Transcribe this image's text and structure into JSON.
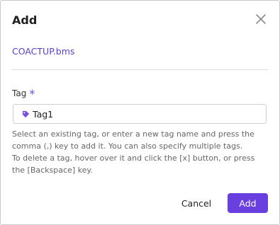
{
  "dialog": {
    "title": "Add",
    "close_icon": "close-icon"
  },
  "file": {
    "name": "COACTUP.bms"
  },
  "tag_field": {
    "label": "Tag",
    "required_marker": "*",
    "tags": [
      "Tag1"
    ],
    "tag_icon": "tag-icon",
    "help_lines": [
      "Select an existing tag, or enter a new tag name and press the",
      "comma (,) key to add it. You can also specify multiple tags.",
      "To delete a tag, hover over it and click the [x] button, or press",
      "the [Backspace] key."
    ]
  },
  "buttons": {
    "cancel_label": "Cancel",
    "add_label": "Add"
  },
  "colors": {
    "accent": "#6a3fe0",
    "link": "#5b3fd1"
  }
}
